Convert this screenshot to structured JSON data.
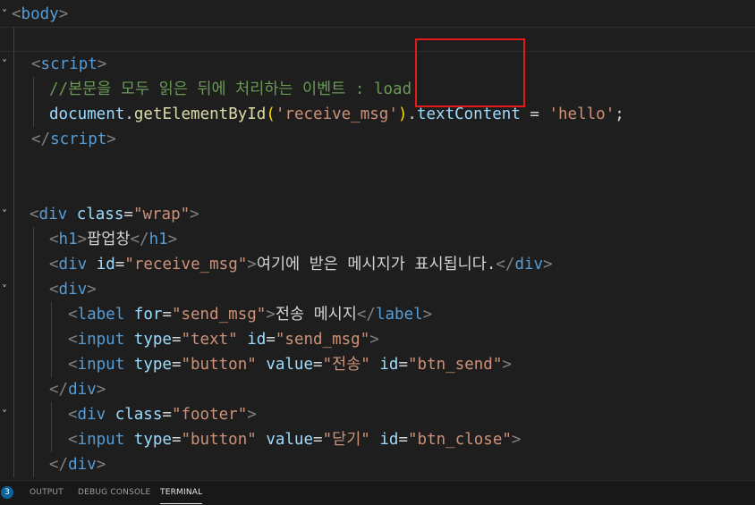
{
  "editor": {
    "lines": [
      [
        [
          "t-punct",
          "<"
        ],
        [
          "t-tag",
          "body"
        ],
        [
          "t-punct",
          ">"
        ]
      ],
      [],
      [
        [
          "t-punct",
          "<"
        ],
        [
          "t-tag",
          "script"
        ],
        [
          "t-punct",
          ">"
        ]
      ],
      [
        [
          "t-comment",
          "//본문을 모두 읽은 뒤에 처리하는 이벤트 : load"
        ]
      ],
      [
        [
          "t-var",
          "document"
        ],
        [
          "t-text",
          "."
        ],
        [
          "t-func",
          "getElementById"
        ],
        [
          "t-brace",
          "("
        ],
        [
          "t-str",
          "'receive_msg'"
        ],
        [
          "t-brace",
          ")"
        ],
        [
          "t-text",
          "."
        ],
        [
          "t-var",
          "textContent"
        ],
        [
          "t-text",
          " = "
        ],
        [
          "t-str",
          "'hello'"
        ],
        [
          "t-text",
          ";"
        ]
      ],
      [
        [
          "t-punct",
          "</"
        ],
        [
          "t-tag",
          "script"
        ],
        [
          "t-punct",
          ">"
        ]
      ],
      [],
      [],
      [
        [
          "t-punct",
          "<"
        ],
        [
          "t-tag",
          "div"
        ],
        [
          "t-text",
          " "
        ],
        [
          "t-attr",
          "class"
        ],
        [
          "t-eq",
          "="
        ],
        [
          "t-str",
          "\"wrap\""
        ],
        [
          "t-punct",
          ">"
        ]
      ],
      [
        [
          "t-punct",
          "<"
        ],
        [
          "t-tag",
          "h1"
        ],
        [
          "t-punct",
          ">"
        ],
        [
          "t-text",
          "팝업창"
        ],
        [
          "t-punct",
          "</"
        ],
        [
          "t-tag",
          "h1"
        ],
        [
          "t-punct",
          ">"
        ]
      ],
      [
        [
          "t-punct",
          "<"
        ],
        [
          "t-tag",
          "div"
        ],
        [
          "t-text",
          " "
        ],
        [
          "t-attr",
          "id"
        ],
        [
          "t-eq",
          "="
        ],
        [
          "t-str",
          "\"receive_msg\""
        ],
        [
          "t-punct",
          ">"
        ],
        [
          "t-text",
          "여기에 받은 메시지가 표시됩니다."
        ],
        [
          "t-punct",
          "</"
        ],
        [
          "t-tag",
          "div"
        ],
        [
          "t-punct",
          ">"
        ]
      ],
      [
        [
          "t-punct",
          "<"
        ],
        [
          "t-tag",
          "div"
        ],
        [
          "t-punct",
          ">"
        ]
      ],
      [
        [
          "t-punct",
          "<"
        ],
        [
          "t-tag",
          "label"
        ],
        [
          "t-text",
          " "
        ],
        [
          "t-attr",
          "for"
        ],
        [
          "t-eq",
          "="
        ],
        [
          "t-str",
          "\"send_msg\""
        ],
        [
          "t-punct",
          ">"
        ],
        [
          "t-text",
          "전송 메시지"
        ],
        [
          "t-punct",
          "</"
        ],
        [
          "t-tag",
          "label"
        ],
        [
          "t-punct",
          ">"
        ]
      ],
      [
        [
          "t-punct",
          "<"
        ],
        [
          "t-tag",
          "input"
        ],
        [
          "t-text",
          " "
        ],
        [
          "t-attr",
          "type"
        ],
        [
          "t-eq",
          "="
        ],
        [
          "t-str",
          "\"text\""
        ],
        [
          "t-text",
          " "
        ],
        [
          "t-attr",
          "id"
        ],
        [
          "t-eq",
          "="
        ],
        [
          "t-str",
          "\"send_msg\""
        ],
        [
          "t-punct",
          ">"
        ]
      ],
      [
        [
          "t-punct",
          "<"
        ],
        [
          "t-tag",
          "input"
        ],
        [
          "t-text",
          " "
        ],
        [
          "t-attr",
          "type"
        ],
        [
          "t-eq",
          "="
        ],
        [
          "t-str",
          "\"button\""
        ],
        [
          "t-text",
          " "
        ],
        [
          "t-attr",
          "value"
        ],
        [
          "t-eq",
          "="
        ],
        [
          "t-str",
          "\"전송\""
        ],
        [
          "t-text",
          " "
        ],
        [
          "t-attr",
          "id"
        ],
        [
          "t-eq",
          "="
        ],
        [
          "t-str",
          "\"btn_send\""
        ],
        [
          "t-punct",
          ">"
        ]
      ],
      [
        [
          "t-punct",
          "</"
        ],
        [
          "t-tag",
          "div"
        ],
        [
          "t-punct",
          ">"
        ]
      ],
      [
        [
          "t-punct",
          "<"
        ],
        [
          "t-tag",
          "div"
        ],
        [
          "t-text",
          " "
        ],
        [
          "t-attr",
          "class"
        ],
        [
          "t-eq",
          "="
        ],
        [
          "t-str",
          "\"footer\""
        ],
        [
          "t-punct",
          ">"
        ]
      ],
      [
        [
          "t-punct",
          "<"
        ],
        [
          "t-tag",
          "input"
        ],
        [
          "t-text",
          " "
        ],
        [
          "t-attr",
          "type"
        ],
        [
          "t-eq",
          "="
        ],
        [
          "t-str",
          "\"button\""
        ],
        [
          "t-text",
          " "
        ],
        [
          "t-attr",
          "value"
        ],
        [
          "t-eq",
          "="
        ],
        [
          "t-str",
          "\"닫기\""
        ],
        [
          "t-text",
          " "
        ],
        [
          "t-attr",
          "id"
        ],
        [
          "t-eq",
          "="
        ],
        [
          "t-str",
          "\"btn_close\""
        ],
        [
          "t-punct",
          ">"
        ]
      ],
      [
        [
          "t-punct",
          "</"
        ],
        [
          "t-tag",
          "div"
        ],
        [
          "t-punct",
          ">"
        ]
      ]
    ]
  },
  "panel": {
    "badge_count": "3",
    "tabs": [
      "OUTPUT",
      "DEBUG CONSOLE",
      "TERMINAL"
    ],
    "active_tab": "TERMINAL"
  },
  "colors": {
    "background": "#1e1e1e",
    "highlight_box": "#e51b1b"
  }
}
